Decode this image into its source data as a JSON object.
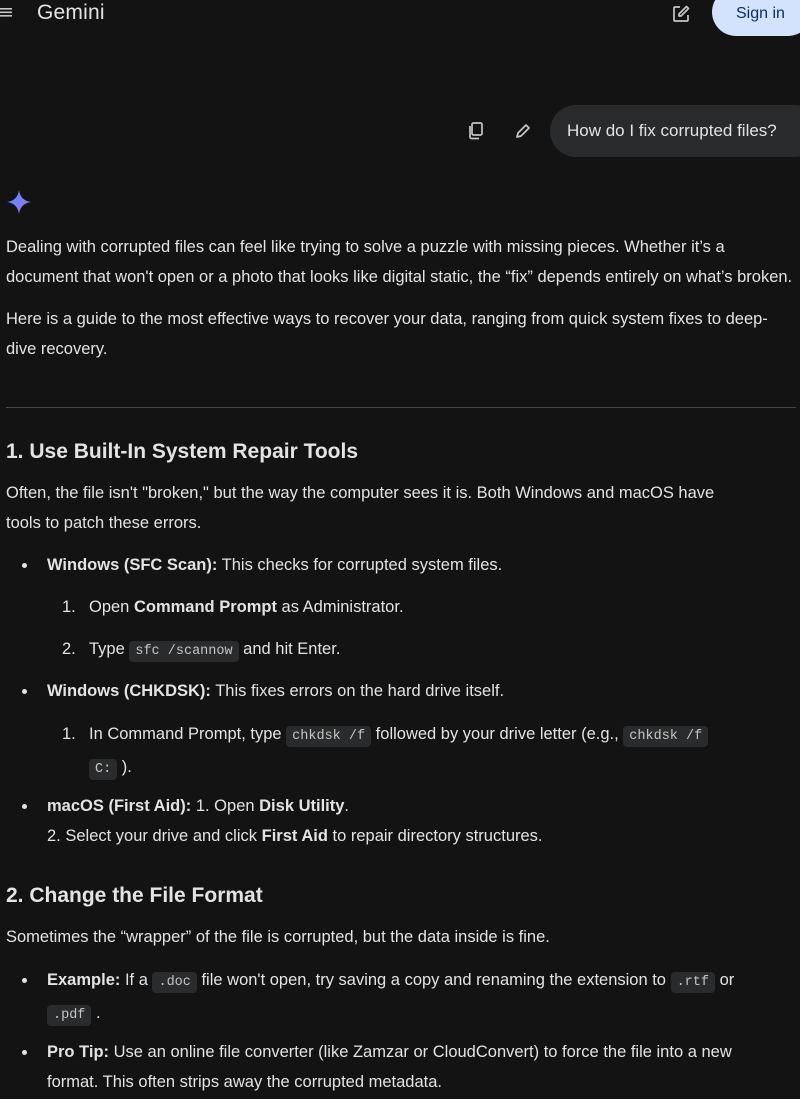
{
  "header": {
    "menu_icon": "hamburger-menu-icon",
    "app_title": "Gemini",
    "new_chat_icon": "edit-square-icon",
    "signin_label": "Sign in"
  },
  "prompt": {
    "copy_icon": "copy-icon",
    "edit_icon": "pencil-icon",
    "text": "How do I fix corrupted files?"
  },
  "response": {
    "avatar_icon": "gemini-sparkle-icon",
    "intro_1": "Dealing with corrupted files can feel like trying to solve a puzzle with missing pieces. Whether it’s a document that won't open or a photo that looks like digital static, the “fix” depends entirely on what’s broken.",
    "intro_2": "Here is a guide to the most effective ways to recover your data, ranging from quick system fixes to deep-dive recovery.",
    "section1": {
      "heading": "1. Use Built-In System Repair Tools",
      "para_line1": "Often, the file isn't \"broken,\" but the way the computer sees it is. Both Windows and macOS have",
      "para_line2": "tools to patch these errors.",
      "win_sfc_bold": "Windows (SFC Scan):",
      "win_sfc_text": " This checks for corrupted system files.",
      "step1_num": "1.",
      "step1_pre": "Open ",
      "step1_bold": "Command Prompt",
      "step1_post": " as Administrator.",
      "step2_num": "2.",
      "step2_pre": "Type ",
      "step2_code": "sfc /scannow",
      "step2_post": " and hit Enter.",
      "win_chk_bold": "Windows (CHKDSK):",
      "win_chk_text": " This fixes errors on the hard drive itself.",
      "chk_num": "1.",
      "chk_pre": "In Command Prompt, type ",
      "chk_code1": "chkdsk /f",
      "chk_mid": " followed by your drive letter (e.g., ",
      "chk_code2a": "chkdsk /f",
      "chk_code2b": "C:",
      "chk_post": " ).",
      "mac_bold": "macOS (First Aid):",
      "mac_text1": " 1. Open ",
      "mac_bold2": "Disk Utility",
      "mac_text2": ".",
      "mac_line2_pre": "2. Select your drive and click ",
      "mac_line2_bold": "First Aid",
      "mac_line2_post": " to repair directory structures."
    },
    "section2": {
      "heading": "2. Change the File Format",
      "para": "Sometimes the “wrapper” of the file is corrupted, but the data inside is fine.",
      "ex_bold": "Example:",
      "ex_pre": " If a ",
      "ex_code1": ".doc",
      "ex_mid": " file won't open, try saving a copy and renaming the extension to ",
      "ex_code2": ".rtf",
      "ex_or": " or",
      "ex_code3": ".pdf",
      "ex_end": " .",
      "tip_bold": "Pro Tip:",
      "tip_line1": " Use an online file converter (like Zamzar or CloudConvert) to force the file into a new",
      "tip_line2": "format. This often strips away the corrupted metadata."
    }
  }
}
